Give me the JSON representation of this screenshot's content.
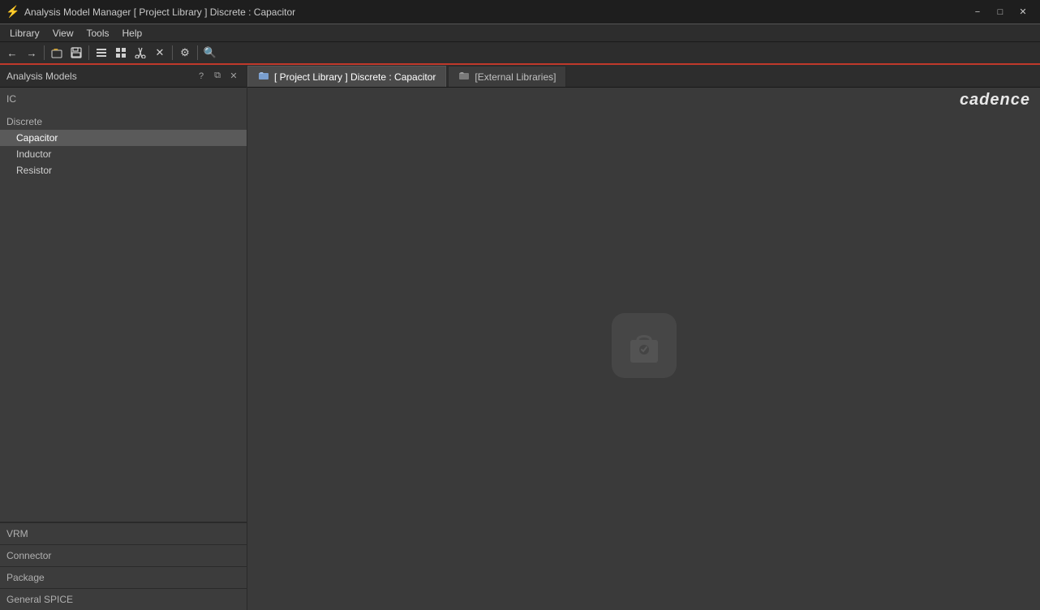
{
  "titleBar": {
    "title": "Analysis Model Manager [ Project Library ] Discrete : Capacitor",
    "icon": "⚡",
    "controls": {
      "minimize": "−",
      "maximize": "□",
      "close": "✕"
    }
  },
  "menuBar": {
    "items": [
      "Library",
      "View",
      "Tools",
      "Help"
    ]
  },
  "toolbar": {
    "buttons": [
      "←",
      "→",
      "📁",
      "💾",
      "⊟",
      "⊞",
      "✂",
      "✕",
      "⚙",
      "🔍"
    ]
  },
  "sidebar": {
    "title": "Analysis Models",
    "controls": [
      "?",
      "⧉",
      "✕"
    ],
    "categories": {
      "ic": {
        "label": "IC",
        "items": []
      },
      "discrete": {
        "label": "Discrete",
        "items": [
          "Capacitor",
          "Inductor",
          "Resistor"
        ]
      }
    },
    "bottomCategories": [
      "VRM",
      "Connector",
      "Package",
      "General SPICE"
    ]
  },
  "tabs": [
    {
      "label": "[ Project Library ] Discrete : Capacitor",
      "active": true,
      "iconType": "folder"
    },
    {
      "label": "[External Libraries]",
      "active": false,
      "iconType": "folder"
    }
  ],
  "content": {
    "selectedItem": "Capacitor",
    "empty": true
  },
  "logo": "cadence"
}
